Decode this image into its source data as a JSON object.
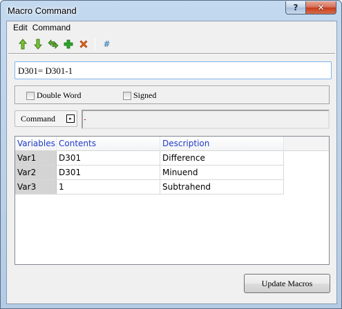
{
  "window": {
    "title": "Macro Command",
    "help_label": "?",
    "close_label": "✕"
  },
  "menu": {
    "items": [
      "Edit",
      "Command"
    ]
  },
  "toolbar": {
    "icons": [
      "move-up-icon",
      "move-down-icon",
      "swap-icon",
      "add-icon",
      "delete-icon",
      "hash-icon"
    ],
    "hash_label": "#"
  },
  "formula": {
    "value": "D301= D301-1"
  },
  "options": {
    "double_word": "Double Word",
    "signed": "Signed"
  },
  "command": {
    "label": "Command",
    "arrow": "▸"
  },
  "table": {
    "headers": [
      "Variables",
      "Contents",
      "Description"
    ],
    "rows": [
      {
        "var": "Var1",
        "contents": "D301",
        "description": "Difference"
      },
      {
        "var": "Var2",
        "contents": "D301",
        "description": "Minuend"
      },
      {
        "var": "Var3",
        "contents": "1",
        "description": "Subtrahend"
      }
    ]
  },
  "buttons": {
    "update": "Update Macros"
  },
  "colors": {
    "header_text": "#1e3ac7",
    "arrow_green": "#56a11e",
    "close_red": "#c43b1a",
    "focus_border": "#7eb4ea"
  }
}
